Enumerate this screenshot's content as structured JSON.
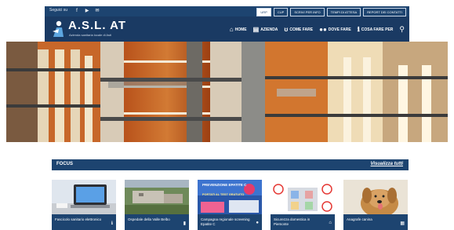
{
  "topbar": {
    "follow_label": "Seguici su",
    "social": [
      {
        "name": "facebook-icon",
        "glyph": "f"
      },
      {
        "name": "youtube-icon",
        "glyph": "▶"
      },
      {
        "name": "email-icon",
        "glyph": "✉"
      }
    ],
    "links": [
      {
        "label": "URP",
        "active": true
      },
      {
        "label": "CUP",
        "active": false
      },
      {
        "label": "SCRIVI PER INFO",
        "active": false
      },
      {
        "label": "TEMPI DI ATTESA",
        "active": false
      },
      {
        "label": "REPORT DEI CONTATTI",
        "active": false
      }
    ]
  },
  "header": {
    "logo_title": "A.S.L. AT",
    "logo_subtitle": "Azienda sanitaria locale di Asti",
    "nav": [
      {
        "label": "HOME",
        "icon": "home-icon"
      },
      {
        "label": "AZIENDA",
        "icon": "building-icon"
      },
      {
        "label": "COME FARE",
        "icon": "stethoscope-icon"
      },
      {
        "label": "DOVE FARE",
        "icon": "people-icon"
      },
      {
        "label": "COSA FARE PER",
        "icon": "info-icon"
      }
    ],
    "search_icon": "search-icon"
  },
  "focus": {
    "title": "FOCUS",
    "view_all": "Visualizza tutti"
  },
  "cards": [
    {
      "caption": "Fascicolo sanitario elettronico",
      "icon": "info-icon",
      "glyph": "ℹ"
    },
    {
      "caption": "Ospedale della Valle Belbo",
      "icon": "trash-icon",
      "glyph": "▮"
    },
    {
      "caption": "Campagna regionale screening Epatite C",
      "icon": "user-icon",
      "glyph": "●"
    },
    {
      "caption": "Sicurezza domestica in Piemonte",
      "icon": "home-icon",
      "glyph": "⌂"
    },
    {
      "caption": "Anagrafe canina",
      "icon": "calendar-icon",
      "glyph": "▦"
    }
  ],
  "card3_banner": {
    "line1": "PREVENZIONE EPATITE C",
    "line2": "PORTATI AL TEST GRATUITO"
  },
  "colors": {
    "primary": "#1d4470",
    "header": "#1a3a63"
  }
}
